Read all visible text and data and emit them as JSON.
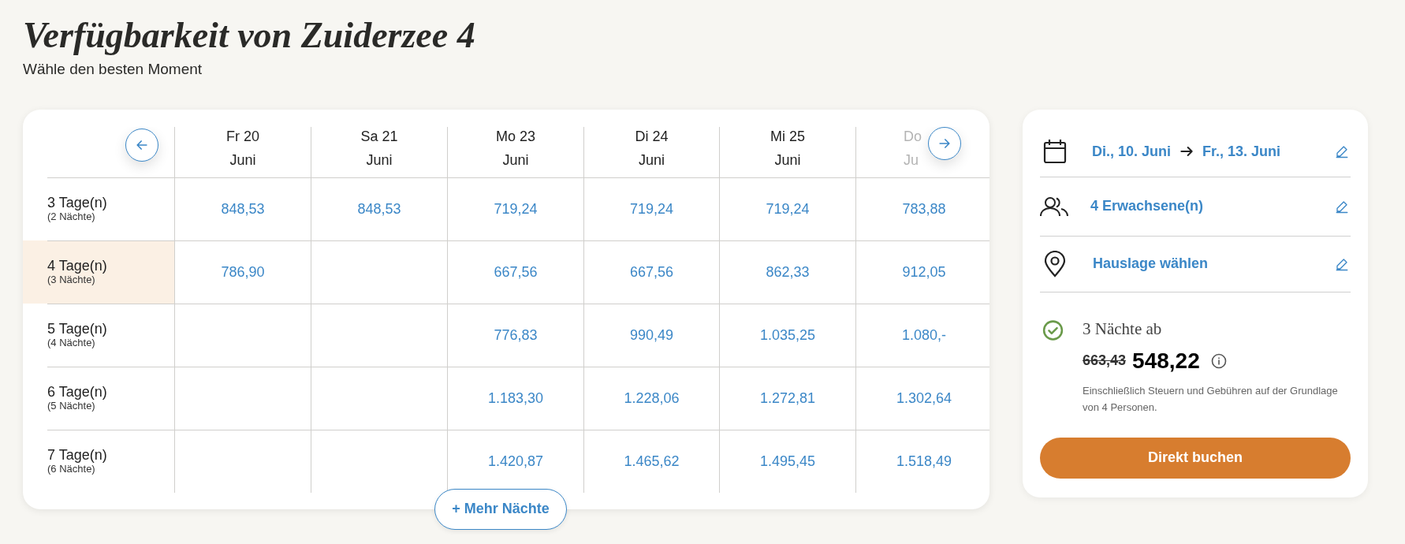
{
  "title": "Verfügbarkeit von Zuiderzee 4",
  "subtitle": "Wähle den besten Moment",
  "table": {
    "columns": [
      {
        "day": "Fr 20",
        "month": "Juni",
        "dimmed": false
      },
      {
        "day": "Sa 21",
        "month": "Juni",
        "dimmed": false
      },
      {
        "day": "Mo 23",
        "month": "Juni",
        "dimmed": false
      },
      {
        "day": "Di 24",
        "month": "Juni",
        "dimmed": false
      },
      {
        "day": "Mi 25",
        "month": "Juni",
        "dimmed": false
      },
      {
        "day": "Do",
        "month": "Ju",
        "dimmed": true
      }
    ],
    "rows": [
      {
        "label": "3 Tage(n)",
        "sublabel": "(2 Nächte)",
        "selected": false,
        "cells": [
          {
            "kind": "price",
            "price": "848,53"
          },
          {
            "kind": "price",
            "price": "848,53"
          },
          {
            "kind": "price",
            "price": "719,24"
          },
          {
            "kind": "price",
            "price": "719,24"
          },
          {
            "kind": "price",
            "price": "719,24"
          },
          {
            "kind": "price",
            "price": "783,88"
          }
        ]
      },
      {
        "label": "4 Tage(n)",
        "sublabel": "(3 Nächte)",
        "selected": true,
        "cells": [
          {
            "kind": "price",
            "price": "786,90"
          },
          {
            "kind": "empty"
          },
          {
            "kind": "price",
            "price": "667,56"
          },
          {
            "kind": "price",
            "price": "667,56"
          },
          {
            "kind": "price",
            "price": "862,33"
          },
          {
            "kind": "price",
            "price": "912,05"
          }
        ]
      },
      {
        "label": "5 Tage(n)",
        "sublabel": "(4 Nächte)",
        "selected": false,
        "cells": [
          {
            "kind": "empty"
          },
          {
            "kind": "empty"
          },
          {
            "kind": "price",
            "price": "776,83"
          },
          {
            "kind": "price",
            "price": "990,49"
          },
          {
            "kind": "price",
            "price": "1.035,25"
          },
          {
            "kind": "price",
            "price": "1.080,-"
          }
        ]
      },
      {
        "label": "6 Tage(n)",
        "sublabel": "(5 Nächte)",
        "selected": false,
        "cells": [
          {
            "kind": "empty"
          },
          {
            "kind": "empty"
          },
          {
            "kind": "price",
            "price": "1.183,30"
          },
          {
            "kind": "price",
            "price": "1.228,06"
          },
          {
            "kind": "price",
            "price": "1.272,81"
          },
          {
            "kind": "price",
            "price": "1.302,64"
          }
        ]
      },
      {
        "label": "7 Tage(n)",
        "sublabel": "(6 Nächte)",
        "selected": false,
        "cells": [
          {
            "kind": "empty"
          },
          {
            "kind": "empty"
          },
          {
            "kind": "price",
            "price": "1.420,87"
          },
          {
            "kind": "price",
            "price": "1.465,62"
          },
          {
            "kind": "price",
            "price": "1.495,45"
          },
          {
            "kind": "price",
            "price": "1.518,49"
          }
        ]
      }
    ],
    "more_button": "+ Mehr Nächte"
  },
  "booking": {
    "dates": {
      "from": "Di., 10. Juni",
      "to": "Fr., 13. Juni"
    },
    "guests": "4 Erwachsene(n)",
    "location": "Hauslage wählen",
    "summary": "3 Nächte ab",
    "old_price": "663,43",
    "price": "548,22",
    "note": "Einschließlich Steuern und Gebühren auf der Grundlage von 4 Personen.",
    "button": "Direkt buchen"
  }
}
